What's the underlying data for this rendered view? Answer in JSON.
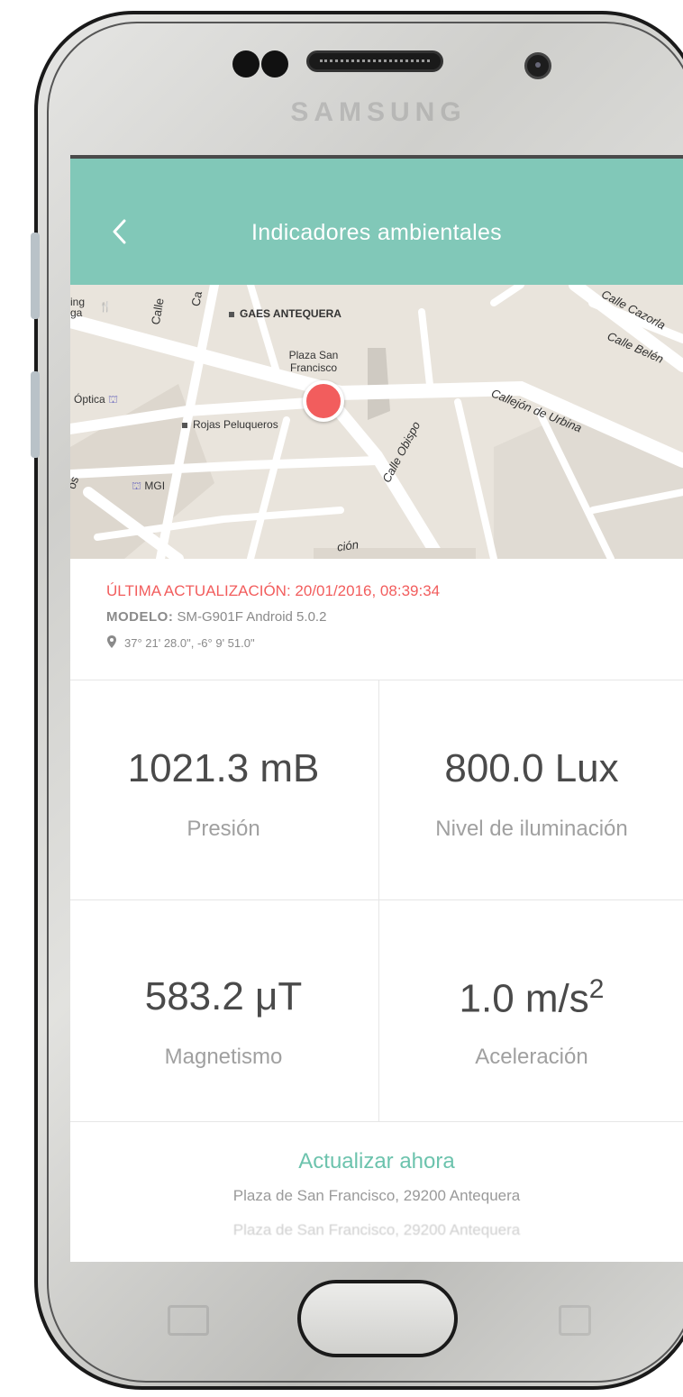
{
  "device": {
    "brand": "SAMSUNG"
  },
  "header": {
    "title": "Indicadores ambientales"
  },
  "map": {
    "labels": {
      "gaes": "GAES ANTEQUERA",
      "plaza": "Plaza San Francisco",
      "optica": "Óptica",
      "rojas": "Rojas Peluqueros",
      "mgi": "MGI",
      "ing": "ing",
      "ga": "ga",
      "calle1": "Calle",
      "ca": "Ca",
      "cazorla": "Calle Cazorla",
      "belen": "Calle Belén",
      "urbina": "Callejón de Urbina",
      "obispo": "Calle Obispo",
      "cion": "ción",
      "os": "os"
    },
    "marker_color": "#f25d5d"
  },
  "info": {
    "update_label": "ÚLTIMA ACTUALIZACIÓN:",
    "update_value": "20/01/2016, 08:39:34",
    "model_label": "MODELO:",
    "model_value": "SM-G901F Android 5.0.2",
    "coords": "37° 21' 28.0\", -6° 9' 51.0\""
  },
  "metrics": {
    "pressure": {
      "value": "1021.3 mB",
      "label": "Presión"
    },
    "light": {
      "value": "800.0 Lux",
      "label": "Nivel de iluminación"
    },
    "magnetism": {
      "value": "583.2 μT",
      "label": "Magnetismo"
    },
    "acceleration": {
      "value": "1.0 m/s",
      "exponent": "2",
      "label": "Aceleración"
    }
  },
  "footer": {
    "action": "Actualizar ahora",
    "address": "Plaza de San Francisco, 29200 Antequera",
    "address_faded": "Plaza de San Francisco, 29200 Antequera"
  },
  "colors": {
    "accent": "#81c8b8",
    "alert": "#f25d5d",
    "action": "#6cc3ad"
  }
}
